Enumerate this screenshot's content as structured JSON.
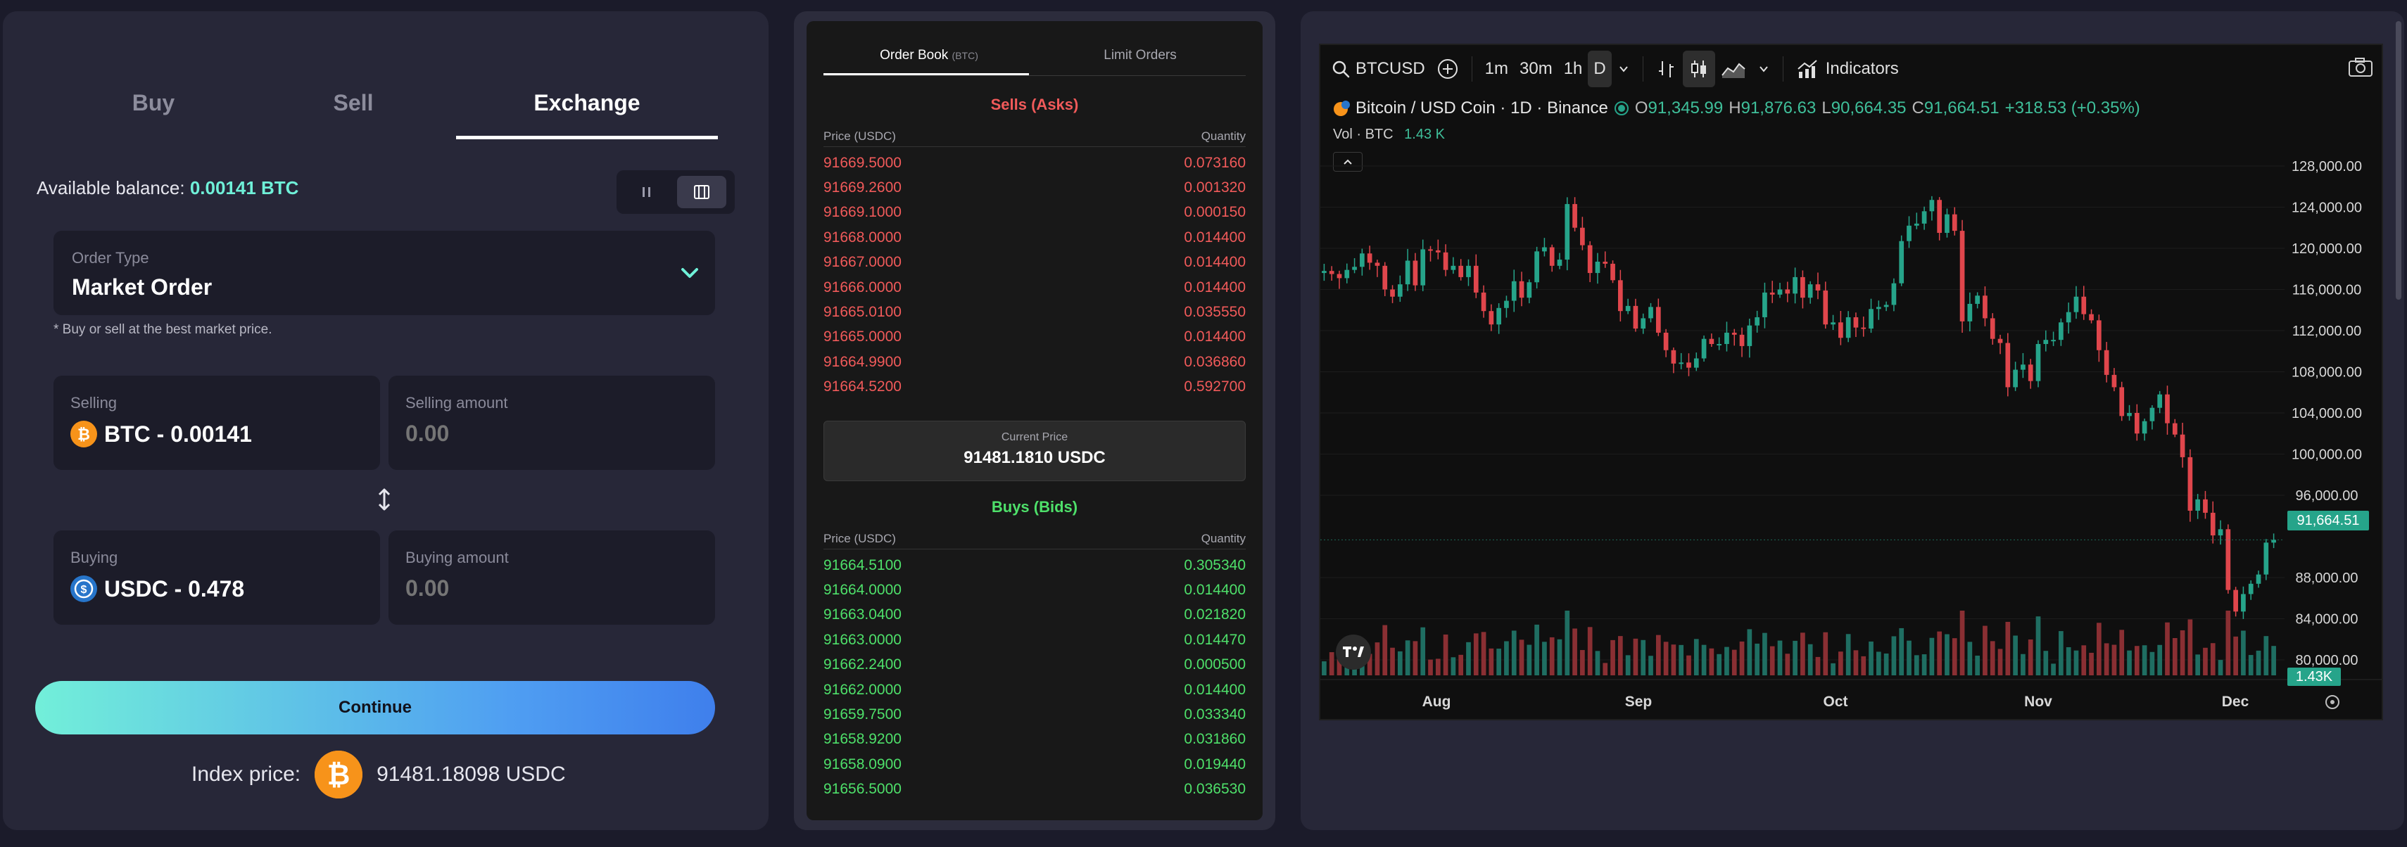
{
  "trade": {
    "tabs": [
      "Buy",
      "Sell",
      "Exchange"
    ],
    "balance_label": "Available balance:",
    "balance_value": "0.00141 BTC",
    "order_type": {
      "label": "Order Type",
      "value": "Market Order",
      "hint": "* Buy or sell at the best market price."
    },
    "selling": {
      "label": "Selling",
      "value": "BTC - 0.00141",
      "amount_label": "Selling amount",
      "amount_placeholder": "0.00"
    },
    "buying": {
      "label": "Buying",
      "value": "USDC - 0.478",
      "amount_label": "Buying amount",
      "amount_placeholder": "0.00"
    },
    "continue_label": "Continue",
    "index_label": "Index price:",
    "index_value": "91481.18098 USDC",
    "colors": {
      "accent": "#6ff0d8",
      "btc": "#f7931a",
      "usdc": "#2775ca"
    }
  },
  "orderbook": {
    "tabs": [
      {
        "label": "Order Book",
        "unit": "(BTC)"
      },
      {
        "label": "Limit Orders",
        "unit": ""
      }
    ],
    "sells_title": "Sells (Asks)",
    "buys_title": "Buys (Bids)",
    "col_price": "Price (USDC)",
    "col_qty": "Quantity",
    "current_label": "Current Price",
    "current_value": "91481.1810 USDC",
    "asks": [
      [
        "91669.5000",
        "0.073160"
      ],
      [
        "91669.2600",
        "0.001320"
      ],
      [
        "91669.1000",
        "0.000150"
      ],
      [
        "91668.0000",
        "0.014400"
      ],
      [
        "91667.0000",
        "0.014400"
      ],
      [
        "91666.0000",
        "0.014400"
      ],
      [
        "91665.0100",
        "0.035550"
      ],
      [
        "91665.0000",
        "0.014400"
      ],
      [
        "91664.9900",
        "0.036860"
      ],
      [
        "91664.5200",
        "0.592700"
      ]
    ],
    "bids": [
      [
        "91664.5100",
        "0.305340"
      ],
      [
        "91664.0000",
        "0.014400"
      ],
      [
        "91663.0400",
        "0.021820"
      ],
      [
        "91663.0000",
        "0.014470"
      ],
      [
        "91662.2400",
        "0.000500"
      ],
      [
        "91662.0000",
        "0.014400"
      ],
      [
        "91659.7500",
        "0.033340"
      ],
      [
        "91658.9200",
        "0.031860"
      ],
      [
        "91658.0900",
        "0.019440"
      ],
      [
        "91656.5000",
        "0.036530"
      ]
    ]
  },
  "chart": {
    "symbol": "BTCUSD",
    "intervals": [
      "1m",
      "30m",
      "1h",
      "D"
    ],
    "indicators_label": "Indicators",
    "title": "Bitcoin / USD Coin · 1D · Binance",
    "ohlc": {
      "o_label": "O",
      "o": "91,345.99",
      "h_label": "H",
      "h": "91,876.63",
      "l_label": "L",
      "l": "90,664.35",
      "c_label": "C",
      "c": "91,664.51",
      "change": "+318.53 (+0.35%)"
    },
    "vol_label": "Vol · BTC",
    "vol_value": "1.43 K",
    "last_price_tag": "91,664.51",
    "last_vol_tag": "1.43K",
    "colors": {
      "up": "#26a48a",
      "down": "#e0464c",
      "vol_up": "#1f6e62",
      "vol_down": "#8a2f33"
    }
  },
  "chart_data": {
    "type": "candlestick",
    "symbol": "BTCUSD",
    "interval": "1D",
    "y_ticks": [
      "128,000.00",
      "124,000.00",
      "120,000.00",
      "116,000.00",
      "112,000.00",
      "108,000.00",
      "104,000.00",
      "100,000.00",
      "96,000.00",
      "88,000.00",
      "84,000.00",
      "80,000.00"
    ],
    "x_ticks": [
      "Aug",
      "Sep",
      "Oct",
      "Nov",
      "Dec"
    ],
    "ylim": [
      78500,
      129500
    ],
    "last_close": 91664.51,
    "closes": [
      117800,
      117500,
      117100,
      117900,
      118200,
      119500,
      118600,
      118300,
      116000,
      115300,
      116500,
      118800,
      116400,
      119900,
      119800,
      119600,
      117900,
      118300,
      117200,
      118300,
      115700,
      113900,
      112600,
      114200,
      114900,
      116800,
      115200,
      116700,
      119700,
      120100,
      118300,
      118900,
      124300,
      122000,
      120300,
      117600,
      118700,
      118500,
      116900,
      113900,
      114400,
      112200,
      113200,
      114300,
      111800,
      110100,
      108800,
      108900,
      108400,
      109300,
      111200,
      110700,
      110700,
      111800,
      111600,
      110500,
      112500,
      113300,
      115700,
      115500,
      116000,
      115600,
      117200,
      115200,
      116500,
      115900,
      112600,
      112800,
      111300,
      113300,
      112300,
      112200,
      114100,
      114300,
      114500,
      116600,
      120700,
      122200,
      122400,
      123600,
      124700,
      121500,
      123300,
      121700,
      112900,
      114600,
      115400,
      113200,
      111200,
      110800,
      106500,
      108200,
      108700,
      107100,
      110700,
      111100,
      111100,
      112800,
      113800,
      115300,
      113600,
      113000,
      110100,
      107700,
      106500,
      103700,
      104000,
      102000,
      103200,
      104500,
      105800,
      103000,
      101900,
      99700,
      94500,
      95600,
      94300,
      92100,
      92700,
      86800,
      84700,
      86400,
      87400,
      88300,
      91400,
      91664
    ],
    "volume_note": "daily BTC volume bars beneath candles"
  }
}
